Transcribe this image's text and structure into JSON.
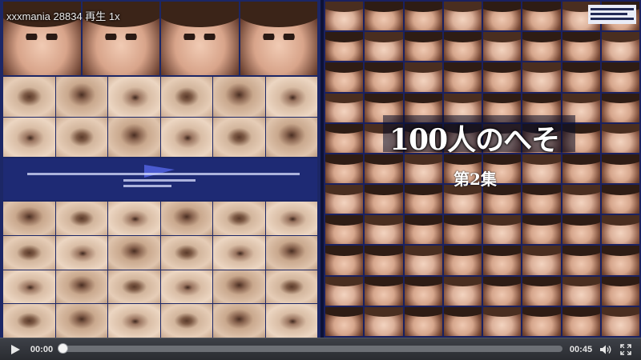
{
  "overlay": {
    "watermark": "xxxmania 28834 再生 1x"
  },
  "poster": {
    "title": "100人のへそ",
    "subtitle": "第2集"
  },
  "controls": {
    "current_time": "00:00",
    "duration": "00:45",
    "progress": 0.0
  },
  "icons": {
    "play": "play-icon",
    "volume": "volume-icon",
    "fullscreen": "fullscreen-icon"
  },
  "colors": {
    "control_bar": "#2f3137",
    "poster_background": "#1c2766",
    "seek_track": "#6c6f75"
  }
}
